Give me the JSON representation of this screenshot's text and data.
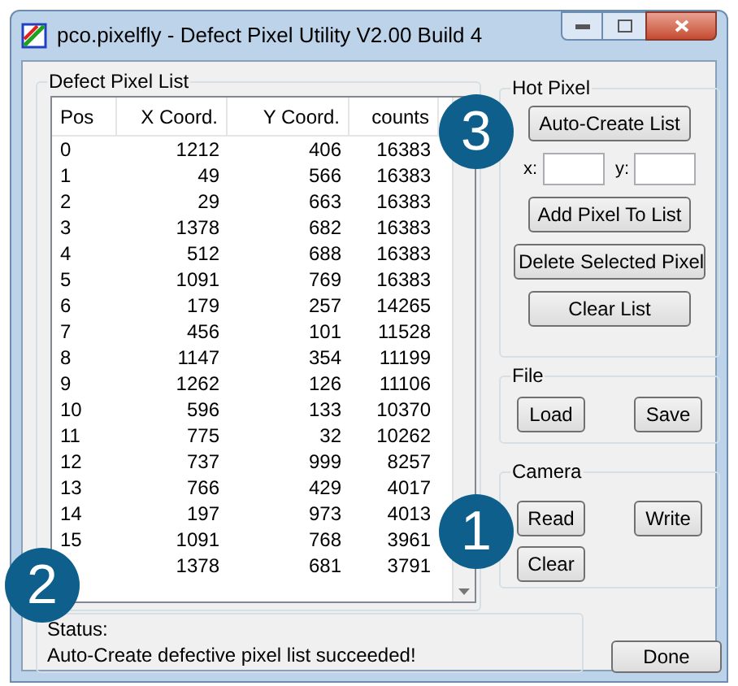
{
  "window": {
    "title": "pco.pixelfly - Defect Pixel Utility V2.00 Build 4"
  },
  "defect_list": {
    "title": "Defect Pixel List",
    "columns": [
      "Pos",
      "X Coord.",
      "Y Coord.",
      "counts"
    ],
    "rows": [
      [
        "0",
        "1212",
        "406",
        "16383"
      ],
      [
        "1",
        "49",
        "566",
        "16383"
      ],
      [
        "2",
        "29",
        "663",
        "16383"
      ],
      [
        "3",
        "1378",
        "682",
        "16383"
      ],
      [
        "4",
        "512",
        "688",
        "16383"
      ],
      [
        "5",
        "1091",
        "769",
        "16383"
      ],
      [
        "6",
        "179",
        "257",
        "14265"
      ],
      [
        "7",
        "456",
        "101",
        "11528"
      ],
      [
        "8",
        "1147",
        "354",
        "11199"
      ],
      [
        "9",
        "1262",
        "126",
        "11106"
      ],
      [
        "10",
        "596",
        "133",
        "10370"
      ],
      [
        "11",
        "775",
        "32",
        "10262"
      ],
      [
        "12",
        "737",
        "999",
        "8257"
      ],
      [
        "13",
        "766",
        "429",
        "4017"
      ],
      [
        "14",
        "197",
        "973",
        "4013"
      ],
      [
        "15",
        "1091",
        "768",
        "3961"
      ],
      [
        null,
        "1378",
        "681",
        "3791"
      ]
    ]
  },
  "hot_pixel": {
    "title": "Hot Pixel",
    "buttons": [
      "Auto-Create List",
      "Add Pixel To List",
      "Delete Selected Pixel",
      "Clear List"
    ],
    "x_label": "x:",
    "y_label": "y:"
  },
  "file": {
    "title": "File",
    "buttons": [
      "Load",
      "Save"
    ]
  },
  "camera": {
    "title": "Camera",
    "buttons": [
      "Read",
      "Write",
      "Clear"
    ]
  },
  "status": {
    "label": "Status:",
    "message": "Auto-Create defective pixel list succeeded!"
  },
  "done_button": "Done",
  "callouts": [
    "3",
    "2",
    "1"
  ]
}
